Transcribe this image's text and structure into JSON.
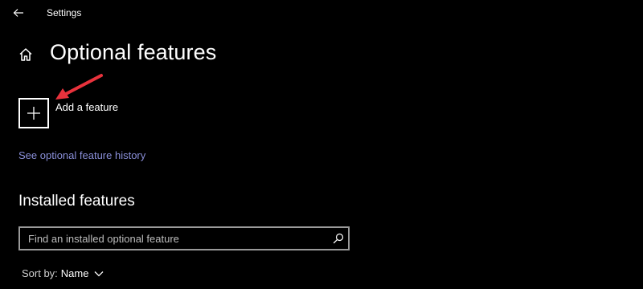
{
  "window": {
    "title": "Settings"
  },
  "header": {
    "title": "Optional features"
  },
  "add_feature": {
    "label": "Add a feature"
  },
  "history_link": {
    "label": "See optional feature history"
  },
  "installed": {
    "heading": "Installed features",
    "search_placeholder": "Find an installed optional feature",
    "search_value": ""
  },
  "sort": {
    "label": "Sort by:",
    "value": "Name"
  },
  "colors": {
    "background": "#000000",
    "text": "#ffffff",
    "link": "#8a8fd9",
    "annotation_arrow": "#e8323c",
    "search_border": "#9a9a9a"
  },
  "icons": {
    "back": "arrow-left-icon",
    "home": "home-icon",
    "add": "plus-icon",
    "search": "search-icon",
    "sort": "chevron-down-icon"
  }
}
